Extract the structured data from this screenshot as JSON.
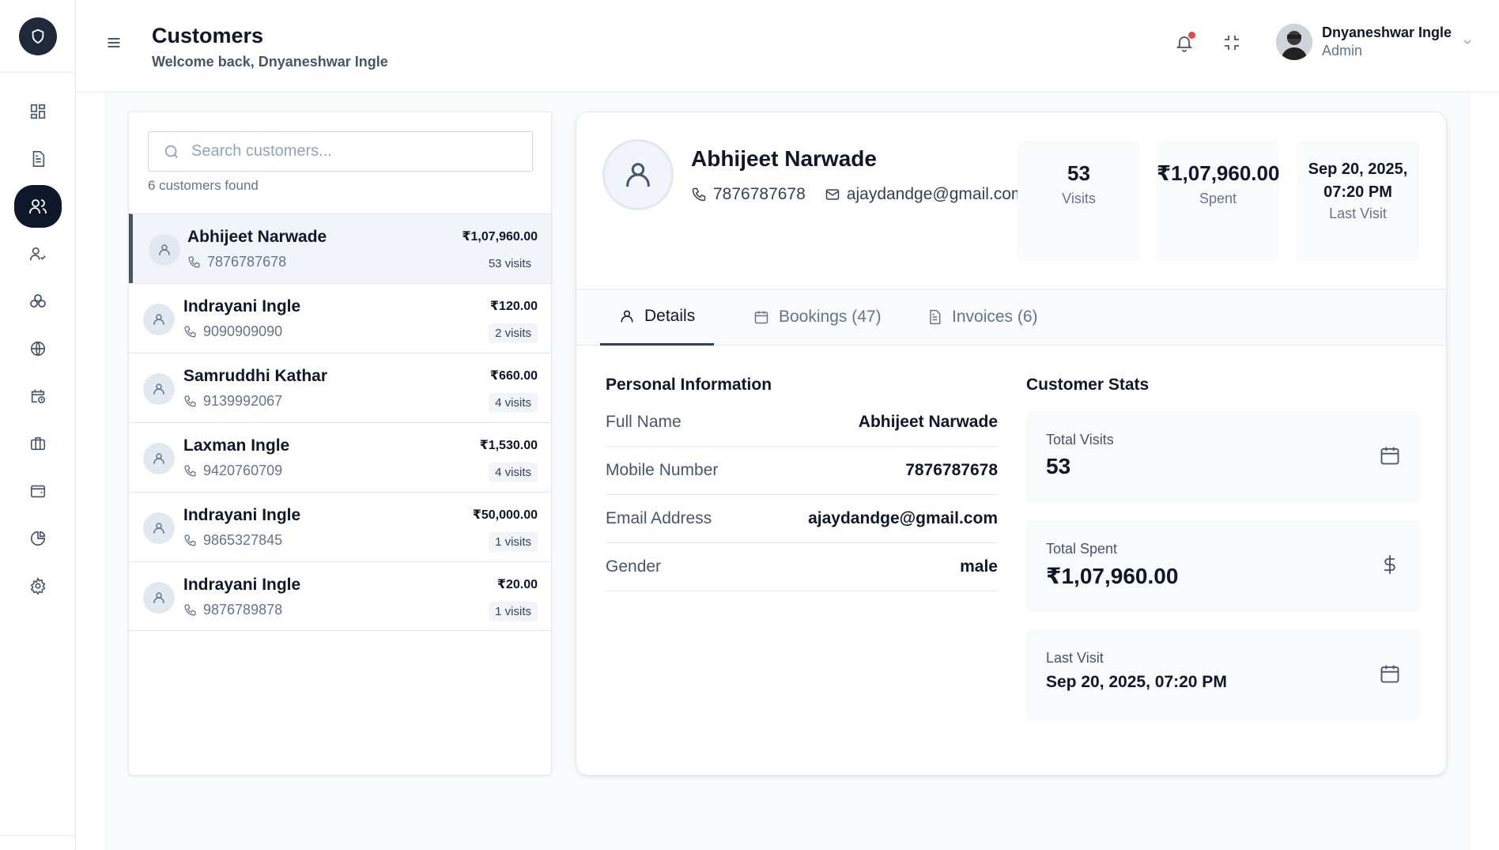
{
  "header": {
    "title": "Customers",
    "subtitle": "Welcome back, Dnyaneshwar Ingle",
    "user_name": "Dnyaneshwar Ingle",
    "user_role": "Admin"
  },
  "sidebar": {
    "items": [
      {
        "icon": "dashboard-icon"
      },
      {
        "icon": "document-icon"
      },
      {
        "icon": "users-icon",
        "active": true
      },
      {
        "icon": "user-check-icon"
      },
      {
        "icon": "services-icon"
      },
      {
        "icon": "globe-icon"
      },
      {
        "icon": "calendar-clock-icon"
      },
      {
        "icon": "briefcase-icon"
      },
      {
        "icon": "wallet-icon"
      },
      {
        "icon": "pie-chart-icon"
      },
      {
        "icon": "settings-icon"
      }
    ]
  },
  "list": {
    "search_placeholder": "Search customers...",
    "found_text": "6 customers found",
    "customers": [
      {
        "name": "Abhijeet Narwade",
        "phone": "7876787678",
        "amount": "₹1,07,960.00",
        "visits": "53 visits",
        "selected": true
      },
      {
        "name": "Indrayani Ingle",
        "phone": "9090909090",
        "amount": "₹120.00",
        "visits": "2 visits"
      },
      {
        "name": "Samruddhi Kathar",
        "phone": "9139992067",
        "amount": "₹660.00",
        "visits": "4 visits"
      },
      {
        "name": "Laxman Ingle",
        "phone": "9420760709",
        "amount": "₹1,530.00",
        "visits": "4 visits"
      },
      {
        "name": "Indrayani Ingle",
        "phone": "9865327845",
        "amount": "₹50,000.00",
        "visits": "1 visits"
      },
      {
        "name": "Indrayani Ingle",
        "phone": "9876789878",
        "amount": "₹20.00",
        "visits": "1 visits"
      }
    ]
  },
  "detail": {
    "name": "Abhijeet Narwade",
    "phone": "7876787678",
    "email": "ajaydandge@gmail.com",
    "stats": {
      "visits_value": "53",
      "visits_label": "Visits",
      "spent_value": "₹1,07,960.00",
      "spent_label": "Spent",
      "last_visit_value": "Sep 20, 2025, 07:20 PM",
      "last_visit_label": "Last Visit"
    },
    "tabs": [
      {
        "label": "Details",
        "active": true
      },
      {
        "label": "Bookings (47)"
      },
      {
        "label": "Invoices (6)"
      }
    ],
    "personal_title": "Personal Information",
    "personal": [
      {
        "key": "Full Name",
        "value": "Abhijeet Narwade"
      },
      {
        "key": "Mobile Number",
        "value": "7876787678"
      },
      {
        "key": "Email Address",
        "value": "ajaydandge@gmail.com"
      },
      {
        "key": "Gender",
        "value": "male"
      }
    ],
    "stats_title": "Customer Stats",
    "customer_stats": [
      {
        "label": "Total Visits",
        "value": "53",
        "icon": "calendar-icon"
      },
      {
        "label": "Total Spent",
        "value": "₹1,07,960.00",
        "icon": "dollar-icon"
      },
      {
        "label": "Last Visit",
        "value": "Sep 20, 2025, 07:20 PM",
        "icon": "calendar-icon"
      }
    ]
  },
  "colors": {
    "primary_dark": "#0f172a",
    "notification": "#ef4444",
    "muted": "#64748b"
  }
}
